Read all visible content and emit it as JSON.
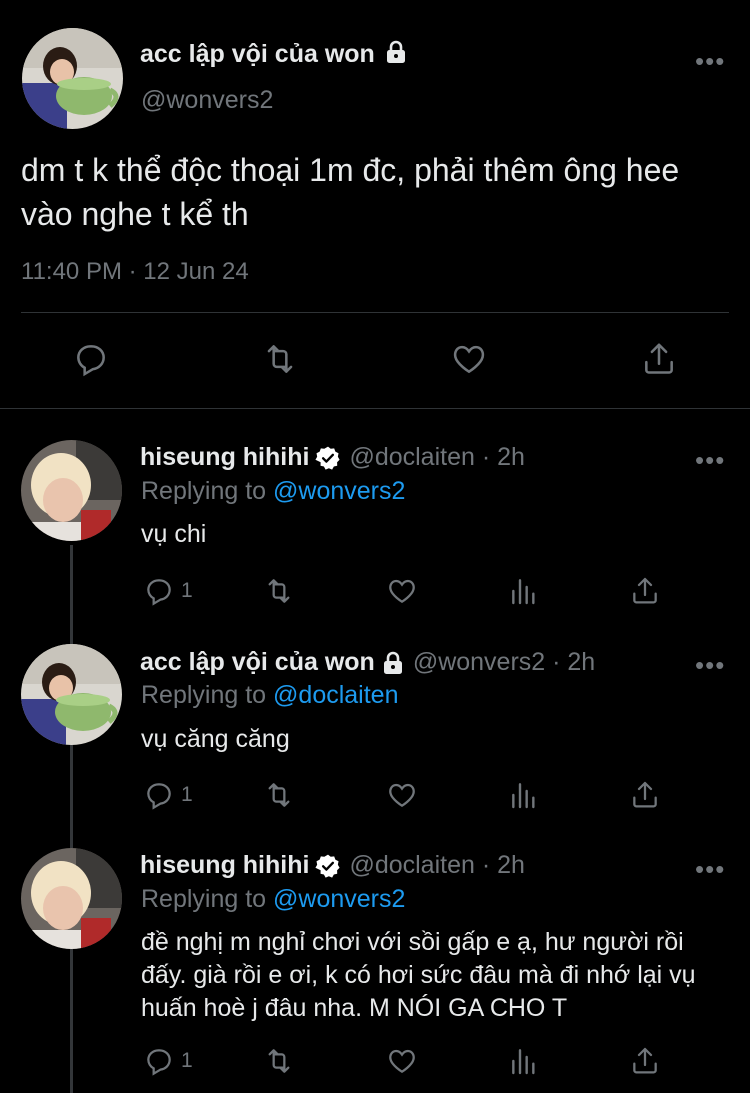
{
  "main_tweet": {
    "author_name": "acc lập vội của won",
    "handle": "@wonvers2",
    "text": "dm t k thể độc thoại 1m đc, phải thêm ông hee vào nghe t kể th",
    "timestamp": "11:40 PM · 12 Jun 24",
    "more": "•••"
  },
  "replies": [
    {
      "author_name": "hiseung hihihi",
      "handle_time": "@doclaiten · 2h",
      "replying_prefix": "Replying to ",
      "replying_to": "@wonvers2",
      "text": "vụ chi",
      "reply_count": "1",
      "more": "•••"
    },
    {
      "author_name": "acc lập vội của won",
      "handle_time": "@wonvers2 · 2h",
      "replying_prefix": "Replying to ",
      "replying_to": "@doclaiten",
      "text": "vụ căng căng",
      "reply_count": "1",
      "more": "•••"
    },
    {
      "author_name": "hiseung hihihi",
      "handle_time": "@doclaiten · 2h",
      "replying_prefix": "Replying to ",
      "replying_to": "@wonvers2",
      "text": "đề nghị m nghỉ chơi với sồi gấp e ạ, hư người rồi đấy. già rồi e ơi, k có hơi sức đâu mà đi nhớ lại vụ huấn hoè j đâu nha. M NÓI GA CHO T",
      "reply_count": "1",
      "more": "•••"
    }
  ],
  "colors": {
    "background": "#000000",
    "text": "#e7e9ea",
    "muted": "#71767b",
    "link": "#1d9bf0",
    "verified_badge": "#ffffff"
  },
  "icons": [
    "lock-icon",
    "verified-badge-icon",
    "reply-icon",
    "retweet-icon",
    "like-icon",
    "share-icon",
    "views-icon"
  ]
}
